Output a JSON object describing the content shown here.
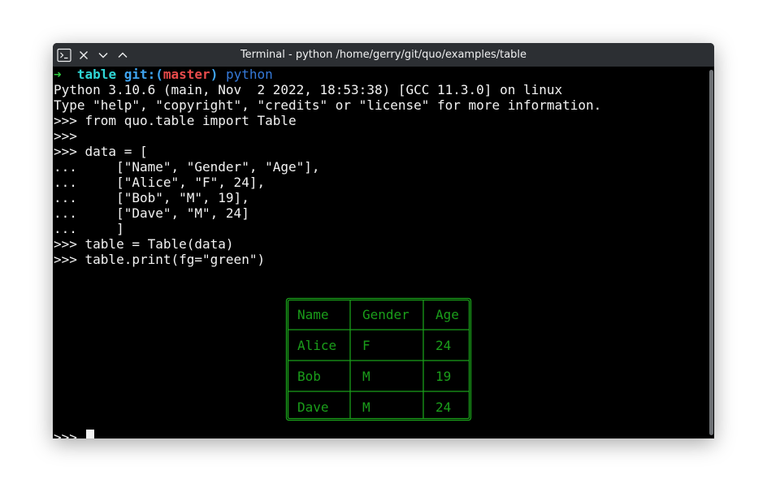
{
  "window": {
    "title": "Terminal - python /home/gerry/git/quo/examples/table"
  },
  "prompt": {
    "arrow": "➜",
    "cwd": "table",
    "git": "git:(",
    "branch": "master",
    "git_close": ")",
    "command": "python"
  },
  "output_lines": [
    "Python 3.10.6 (main, Nov  2 2022, 18:53:38) [GCC 11.3.0] on linux",
    "Type \"help\", \"copyright\", \"credits\" or \"license\" for more information.",
    ">>> from quo.table import Table",
    ">>> ",
    ">>> data = [",
    "...     [\"Name\", \"Gender\", \"Age\"],",
    "...     [\"Alice\", \"F\", 24],",
    "...     [\"Bob\", \"M\", 19],",
    "...     [\"Dave\", \"M\", 24]",
    "...     ]",
    ">>> table = Table(data)",
    ">>> table.print(fg=\"green\")"
  ],
  "table": {
    "color": "#1a9e1a",
    "rows": [
      [
        "Name",
        "Gender",
        "Age"
      ],
      [
        "Alice",
        "F",
        "24"
      ],
      [
        "Bob",
        "M",
        "19"
      ],
      [
        "Dave",
        "M",
        "24"
      ]
    ]
  },
  "final_prompt": ">>> ",
  "icons": {
    "terminal": "terminal-icon",
    "close": "close-icon",
    "minimize": "chevron-down-icon",
    "maximize": "chevron-up-icon"
  }
}
